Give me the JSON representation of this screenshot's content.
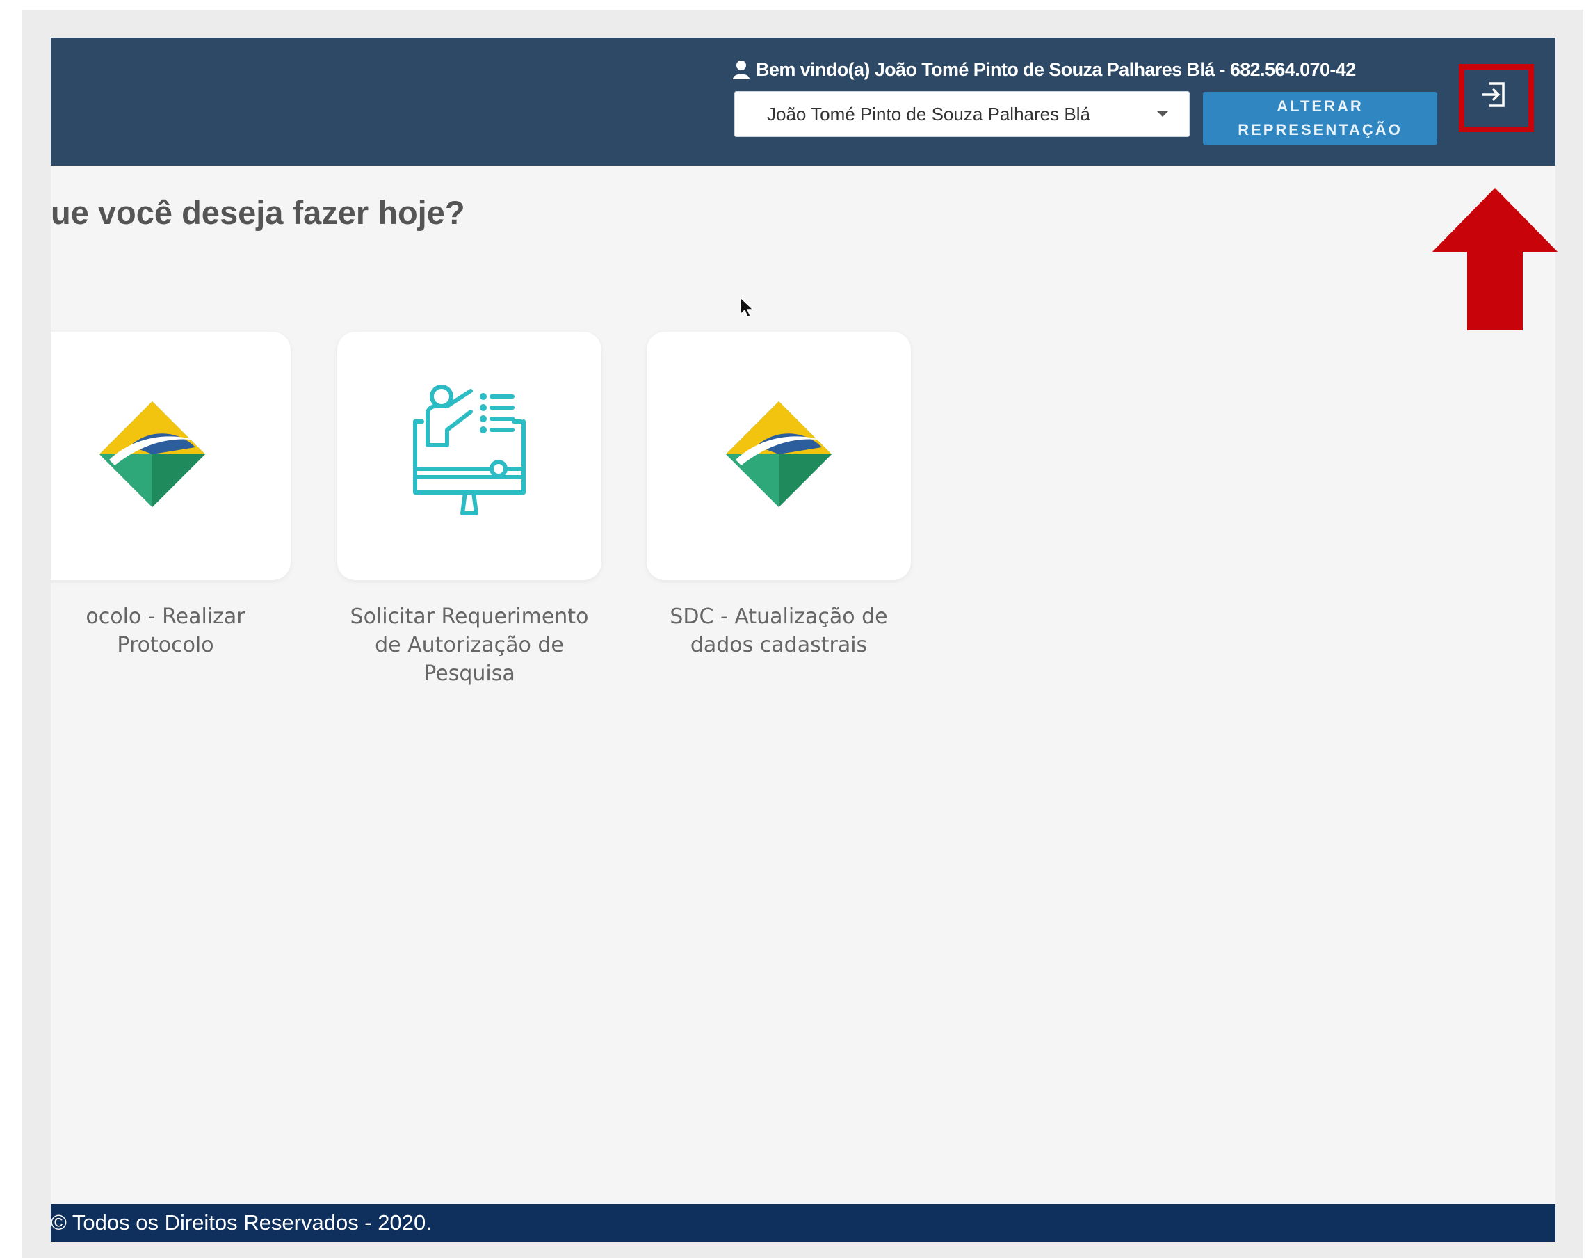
{
  "header": {
    "welcome": "Bem vindo(a) João Tomé Pinto de Souza Palhares Blá - 682.564.070-42",
    "user_icon": "user-icon",
    "representation_select": {
      "value": "João Tomé Pinto de Souza Palhares Blá"
    },
    "alter_button": {
      "line1": "ALTERAR",
      "line2": "REPRESENTAÇÃO"
    },
    "logout_icon": "logout-icon"
  },
  "main": {
    "title": "ue você deseja fazer hoje?",
    "cards": [
      {
        "icon": "gov-logo-icon",
        "label_lines": [
          "ocolo - Realizar",
          "Protocolo"
        ]
      },
      {
        "icon": "presentation-monitor-icon",
        "label_lines": [
          "Solicitar Requerimento",
          "de Autorização de",
          "Pesquisa"
        ]
      },
      {
        "icon": "gov-logo-icon",
        "label_lines": [
          "SDC - Atualização de",
          "dados cadastrais"
        ]
      }
    ]
  },
  "footer": {
    "text": "© Todos os Direitos Reservados - 2020."
  },
  "annotation": {
    "color": "#c8030a",
    "arrow": "up-arrow",
    "box": "highlight-box"
  },
  "colors": {
    "header_bg": "#2e4965",
    "button_bg": "#2f86c1",
    "footer_bg": "#0f2f5c",
    "icon_teal": "#2bbcc4"
  }
}
